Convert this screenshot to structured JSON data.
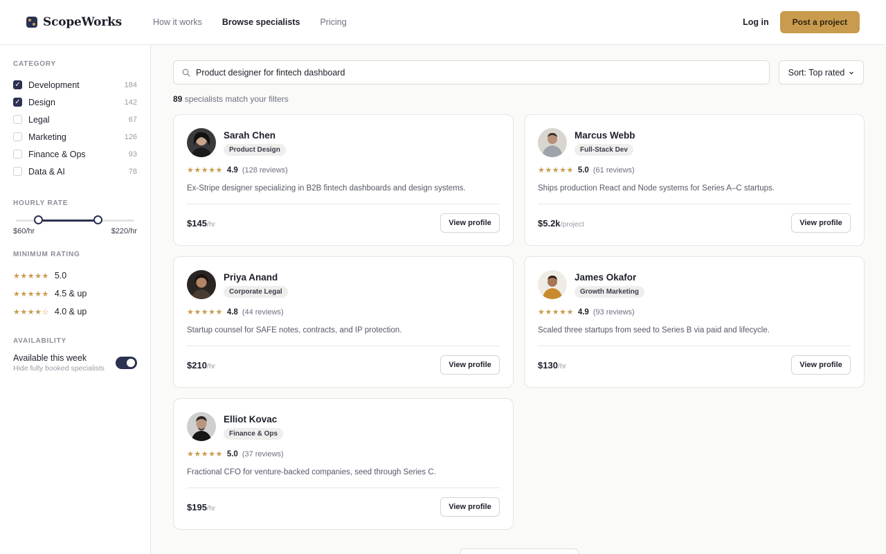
{
  "brand": {
    "name": "ScopeWorks"
  },
  "nav": {
    "items": [
      {
        "label": "How it works"
      },
      {
        "label": "Browse specialists"
      },
      {
        "label": "Pricing"
      }
    ],
    "login_label": "Log in",
    "post_label": "Post a project"
  },
  "filters": {
    "category_title": "CATEGORY",
    "categories": [
      {
        "label": "Development",
        "count": "184",
        "checked": true
      },
      {
        "label": "Design",
        "count": "142",
        "checked": true
      },
      {
        "label": "Legal",
        "count": "67",
        "checked": false
      },
      {
        "label": "Marketing",
        "count": "126",
        "checked": false
      },
      {
        "label": "Finance & Ops",
        "count": "93",
        "checked": false
      },
      {
        "label": "Data & AI",
        "count": "78",
        "checked": false
      }
    ],
    "rate_title": "HOURLY RATE",
    "rate_min": "$60/hr",
    "rate_max": "$220/hr",
    "rating_title": "MINIMUM RATING",
    "ratings": [
      {
        "stars": "★★★★★",
        "label": "5.0"
      },
      {
        "stars": "★★★★★",
        "label": "4.5 & up"
      },
      {
        "stars": "★★★★☆",
        "label": "4.0 & up"
      }
    ],
    "availability_title": "AVAILABILITY",
    "availability_label": "Available this week",
    "availability_hint": "Hide fully booked specialists"
  },
  "search": {
    "value": "Product designer for fintech dashboard",
    "sort_label": "Sort: Top rated"
  },
  "results": {
    "count": "89",
    "text": "specialists match your filters"
  },
  "specialists": [
    {
      "name": "Sarah Chen",
      "tag": "Product Design",
      "stars": "★★★★★",
      "score": "4.9",
      "reviews": "(128 reviews)",
      "desc": "Ex-Stripe designer specializing in B2B fintech dashboards and design systems.",
      "price": "$145",
      "unit": "/hr",
      "cta": "View profile"
    },
    {
      "name": "Marcus Webb",
      "tag": "Full-Stack Dev",
      "stars": "★★★★★",
      "score": "5.0",
      "reviews": "(61 reviews)",
      "desc": "Ships production React and Node systems for Series A–C startups.",
      "price": "$5.2k",
      "unit": "/project",
      "cta": "View profile"
    },
    {
      "name": "Priya Anand",
      "tag": "Corporate Legal",
      "stars": "★★★★★",
      "score": "4.8",
      "reviews": "(44 reviews)",
      "desc": "Startup counsel for SAFE notes, contracts, and IP protection.",
      "price": "$210",
      "unit": "/hr",
      "cta": "View profile"
    },
    {
      "name": "James Okafor",
      "tag": "Growth Marketing",
      "stars": "★★★★★",
      "score": "4.9",
      "reviews": "(93 reviews)",
      "desc": "Scaled three startups from seed to Series B via paid and lifecycle.",
      "price": "$130",
      "unit": "/hr",
      "cta": "View profile"
    },
    {
      "name": "Elliot Kovac",
      "tag": "Finance & Ops",
      "stars": "★★★★★",
      "score": "5.0",
      "reviews": "(37 reviews)",
      "desc": "Fractional CFO for venture-backed companies, seed through Series C.",
      "price": "$195",
      "unit": "/hr",
      "cta": "View profile"
    }
  ],
  "colors": {
    "accent": "#c99b4e",
    "primary": "#2b3150"
  }
}
